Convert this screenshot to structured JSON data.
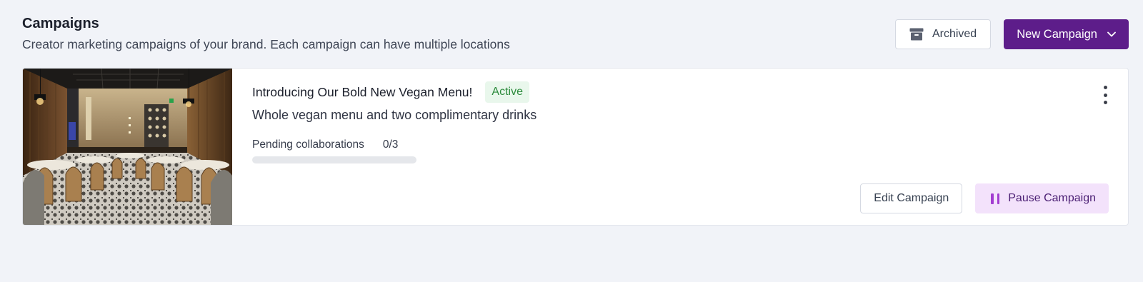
{
  "header": {
    "title": "Campaigns",
    "subtitle": "Creator marketing campaigns of your brand. Each campaign can have multiple locations",
    "archived_label": "Archived",
    "archived_icon": "archive-box-icon",
    "new_campaign_label": "New Campaign",
    "new_campaign_icon": "chevron-down-icon"
  },
  "campaign": {
    "title": "Introducing Our Bold New Vegan Menu!",
    "status": "Active",
    "description": "Whole vegan menu and two complimentary drinks",
    "progress_label": "Pending collaborations",
    "progress_value": "0/3",
    "progress_fraction": 0,
    "image": "restaurant-interior-photo",
    "menu_icon": "more-vertical-icon",
    "edit_label": "Edit Campaign",
    "pause_label": "Pause Campaign",
    "pause_icon": "pause-icon"
  },
  "colors": {
    "primary": "#5d1d8a",
    "status_active_bg": "#e9f7ec",
    "status_active_text": "#2c8b3c",
    "pause_bg": "#f3e2fb",
    "pause_icon": "#a33cd1",
    "page_bg": "#f1f3f8"
  }
}
